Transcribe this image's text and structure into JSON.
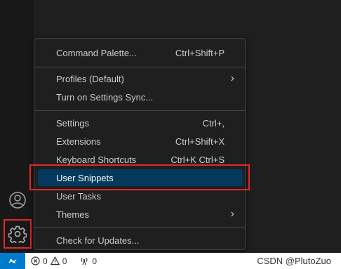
{
  "menu": {
    "items": [
      {
        "label": "Command Palette...",
        "shortcut": "Ctrl+Shift+P"
      },
      {
        "label": "Profiles (Default)",
        "shortcut": "",
        "submenu": true
      },
      {
        "label": "Turn on Settings Sync...",
        "shortcut": ""
      },
      {
        "label": "Settings",
        "shortcut": "Ctrl+,"
      },
      {
        "label": "Extensions",
        "shortcut": "Ctrl+Shift+X"
      },
      {
        "label": "Keyboard Shortcuts",
        "shortcut": "Ctrl+K Ctrl+S"
      },
      {
        "label": "User Snippets",
        "shortcut": "",
        "selected": true
      },
      {
        "label": "User Tasks",
        "shortcut": ""
      },
      {
        "label": "Themes",
        "shortcut": "",
        "submenu": true
      },
      {
        "label": "Check for Updates...",
        "shortcut": ""
      }
    ],
    "submenu_glyph": "›"
  },
  "status_bar": {
    "errors": "0",
    "warnings": "0",
    "ports": "0"
  },
  "watermark": "CSDN @PlutoZuo",
  "colors": {
    "highlight": "#e0282a",
    "selected_bg": "#04395e",
    "remote_bg": "#007acc"
  },
  "icons": {
    "account": "account-icon",
    "manage": "gear-icon",
    "remote": "remote-icon",
    "error": "error-icon",
    "warning": "warning-icon",
    "ports": "broadcast-icon"
  }
}
